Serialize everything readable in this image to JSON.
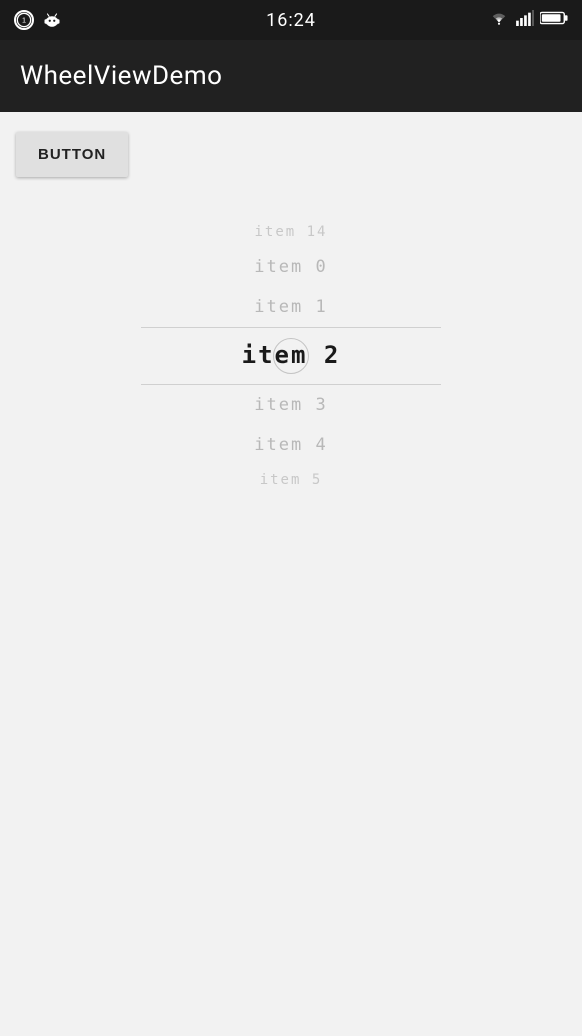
{
  "statusBar": {
    "time": "16:24",
    "notifBadge": "1"
  },
  "appBar": {
    "title": "WheelViewDemo"
  },
  "button": {
    "label": "BUTTON"
  },
  "wheelView": {
    "items": [
      {
        "id": "item-14",
        "label": "item 14",
        "state": "far-top"
      },
      {
        "id": "item-0",
        "label": "item 0",
        "state": "near-top"
      },
      {
        "id": "item-1",
        "label": "item 1",
        "state": "adjacent-top"
      },
      {
        "id": "item-2",
        "label": "item 2",
        "state": "selected"
      },
      {
        "id": "item-3",
        "label": "item 3",
        "state": "adjacent-bottom"
      },
      {
        "id": "item-4",
        "label": "item 4",
        "state": "near-bottom"
      },
      {
        "id": "item-5",
        "label": "item 5",
        "state": "far-bottom"
      }
    ]
  }
}
